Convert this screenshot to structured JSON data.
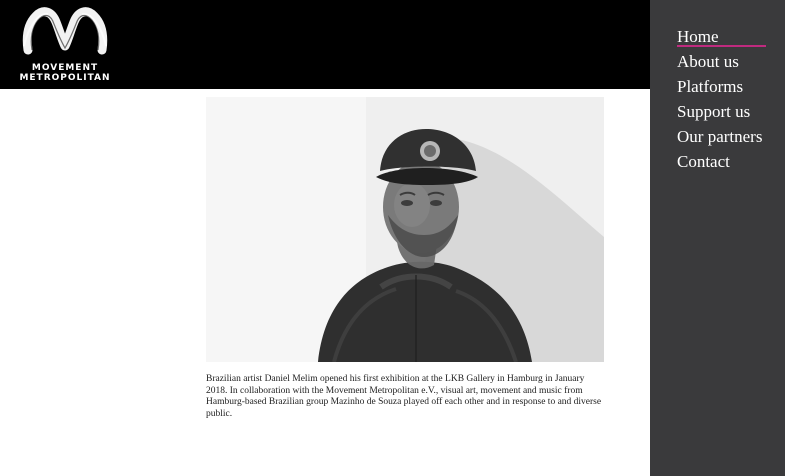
{
  "brand": {
    "line1": "MOVEMENT",
    "line2": "METROPOLITAN"
  },
  "nav": {
    "items": [
      {
        "label": "Home",
        "active": true
      },
      {
        "label": "About us"
      },
      {
        "label": "Platforms"
      },
      {
        "label": "Support us"
      },
      {
        "label": "Our partners"
      },
      {
        "label": "Contact"
      }
    ]
  },
  "photo": {
    "icon": "portrait-photo",
    "tone": "black-and-white"
  },
  "caption": {
    "text": "Brazilian artist Daniel Melim opened his first exhibition at the LKB Gallery in Hamburg in January 2018. In collaboration with the Movement Metropolitan e.V., visual art, movement and music from Hamburg-based Brazilian group Mazinho de Souza played off each other and in response to and diverse public."
  },
  "colors": {
    "header": "#000000",
    "sidebar": "#3a3a3c",
    "accent": "#c02a7f",
    "text": "#ffffff"
  }
}
